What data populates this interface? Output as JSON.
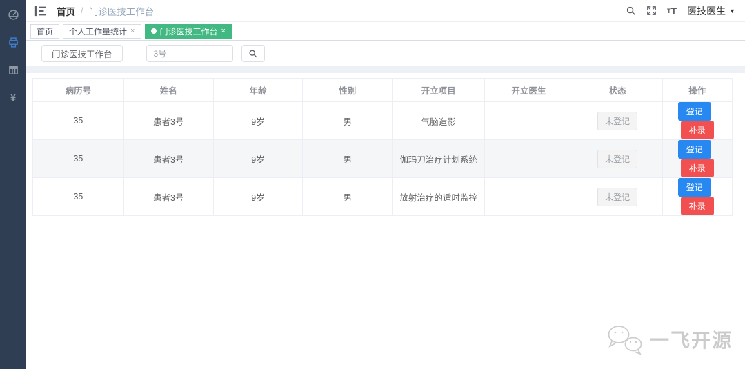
{
  "colors": {
    "sidebar_bg": "#2f3e52",
    "tab_active_green": "#42b983",
    "primary_blue": "#2688f0",
    "danger_red": "#f25050"
  },
  "icons": {
    "close": "×",
    "caret": "▼",
    "yuan": "¥",
    "font_t": "T"
  },
  "sidebar": {
    "items": [
      "dashboard-icon",
      "printer-icon",
      "table-icon",
      "yuan-icon"
    ]
  },
  "header": {
    "breadcrumb": {
      "root": "首页",
      "separator": "/",
      "current": "门诊医技工作台"
    },
    "user": {
      "name": "医技医生"
    }
  },
  "tabs": [
    {
      "label": "首页",
      "active": false,
      "closable": false
    },
    {
      "label": "个人工作量统计",
      "active": false,
      "closable": true
    },
    {
      "label": "门诊医技工作台",
      "active": true,
      "closable": true
    }
  ],
  "toolbar": {
    "title_button": "门诊医技工作台",
    "search_value": "3号"
  },
  "table": {
    "headers": [
      "病历号",
      "姓名",
      "年龄",
      "性别",
      "开立项目",
      "开立医生",
      "状态",
      "操作"
    ],
    "rows": [
      {
        "record_no": "35",
        "name": "患者3号",
        "age": "9岁",
        "gender": "男",
        "item": "气脑造影",
        "doctor": "",
        "status": "未登记"
      },
      {
        "record_no": "35",
        "name": "患者3号",
        "age": "9岁",
        "gender": "男",
        "item": "伽玛刀治疗计划系统",
        "doctor": "",
        "status": "未登记"
      },
      {
        "record_no": "35",
        "name": "患者3号",
        "age": "9岁",
        "gender": "男",
        "item": "放射治疗的适时监控",
        "doctor": "",
        "status": "未登记"
      }
    ],
    "actions": {
      "register": "登记",
      "supplement": "补录"
    }
  },
  "watermark": {
    "text": "一飞开源"
  }
}
